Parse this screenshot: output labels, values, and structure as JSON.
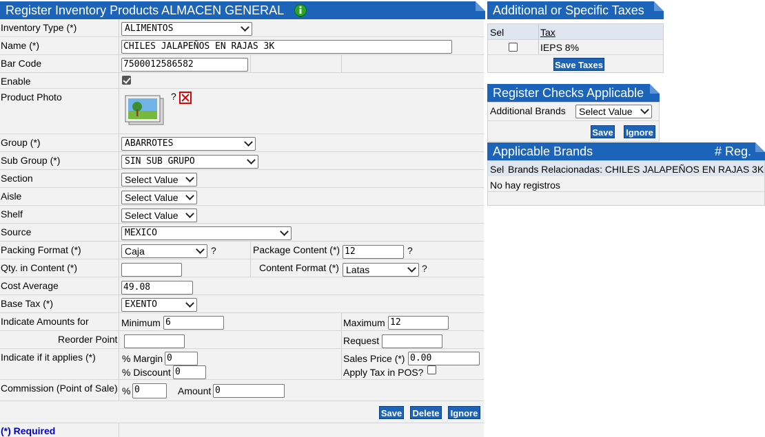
{
  "main": {
    "title": "Register Inventory Products ALMACEN GENERAL",
    "info_icon": "info-icon",
    "fields": {
      "inventory_type": {
        "label": "Inventory Type (*)",
        "value": "ALIMENTOS"
      },
      "name": {
        "label": "Name (*)",
        "value": "CHILES  JALAPEÑOS EN RAJAS 3K"
      },
      "bar_code": {
        "label": "Bar Code",
        "value": "7500012586582"
      },
      "enable": {
        "label": "Enable",
        "checked": true
      },
      "photo": {
        "label": "Product Photo",
        "help": "?"
      },
      "group": {
        "label": "Group (*)",
        "value": "ABARROTES"
      },
      "sub_group": {
        "label": "Sub Group (*)",
        "value": "SIN SUB GRUPO"
      },
      "section": {
        "label": "Section",
        "value": "Select Value"
      },
      "aisle": {
        "label": "Aisle",
        "value": "Select Value"
      },
      "shelf": {
        "label": "Shelf",
        "value": "Select Value"
      },
      "source": {
        "label": "Source",
        "value": "MEXICO"
      },
      "packing_format": {
        "label": "Packing Format (*)",
        "value": "Caja",
        "help": "?"
      },
      "package_content": {
        "label": "Package Content (*)",
        "value": "12",
        "help": "?"
      },
      "qty_in_content": {
        "label": "Qty. in Content (*)",
        "value": ""
      },
      "content_format": {
        "label": "Content Format (*)",
        "value": "Latas",
        "help": "?"
      },
      "cost_average": {
        "label": "Cost Average",
        "value": "49.08"
      },
      "base_tax": {
        "label": "Base Tax (*)",
        "value": "EXENTO"
      },
      "amounts": {
        "label": "Indicate Amounts for",
        "min_label": "Minimum",
        "min_value": "6",
        "max_label": "Maximum",
        "max_value": "12"
      },
      "reorder": {
        "label": "Reorder Point",
        "value": "",
        "request_label": "Request",
        "request_value": ""
      },
      "applies": {
        "label": "Indicate if it applies (*)",
        "margin_label": "% Margin",
        "margin_value": "0",
        "discount_label": "% Discount",
        "discount_value": "0",
        "price_label": "Sales Price (*)",
        "price_value": "0.00",
        "apply_tax_label": "Apply Tax in POS?",
        "apply_tax_checked": false
      },
      "commission": {
        "label": "Commission (Point of Sale)",
        "pct_label": "%",
        "pct_value": "0",
        "amount_label": "Amount",
        "amount_value": "0"
      }
    },
    "buttons": {
      "save": "Save",
      "delete": "Delete",
      "ignore": "Ignore"
    },
    "required_note": "(*) Required"
  },
  "taxes": {
    "title": "Additional or Specific Taxes",
    "col_sel": "Sel",
    "col_tax": "Tax",
    "rows": [
      {
        "tax": "IEPS 8%",
        "checked": false
      }
    ],
    "save": "Save Taxes"
  },
  "checks": {
    "title": "Register Checks Applicable",
    "label": "Additional Brands",
    "value": "Select Value",
    "save": "Save",
    "ignore": "Ignore"
  },
  "brands": {
    "title": "Applicable Brands",
    "reg": "# Reg.",
    "col_sel": "Sel",
    "col_desc": "Brands Relacionadas: CHILES JALAPEÑOS EN RAJAS 3K",
    "empty": "No hay registros"
  },
  "colors": {
    "accent": "#1c63ba",
    "required": "#0000cc",
    "error": "#e00000"
  }
}
